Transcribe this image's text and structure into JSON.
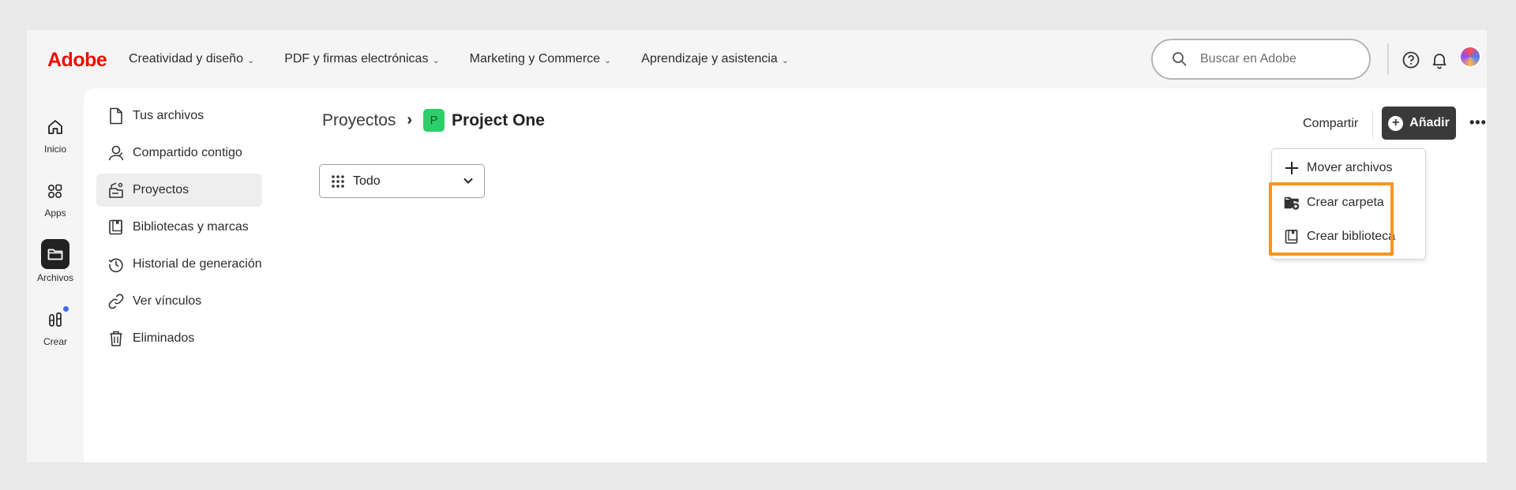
{
  "brand": {
    "name": "Adobe",
    "color": "#eb1000"
  },
  "nav": [
    {
      "label": "Creatividad y diseño"
    },
    {
      "label": "PDF y firmas electrónicas"
    },
    {
      "label": "Marketing y Commerce"
    },
    {
      "label": "Aprendizaje y asistencia"
    }
  ],
  "search": {
    "placeholder": "Buscar en Adobe"
  },
  "rail": [
    {
      "label": "Inicio",
      "icon": "home-icon"
    },
    {
      "label": "Apps",
      "icon": "apps-icon"
    },
    {
      "label": "Archivos",
      "icon": "folder-icon"
    },
    {
      "label": "Crear",
      "icon": "create-icon"
    }
  ],
  "sidebar": [
    {
      "label": "Tus archivos",
      "icon": "file-icon"
    },
    {
      "label": "Compartido contigo",
      "icon": "shared-user-icon"
    },
    {
      "label": "Proyectos",
      "icon": "projects-icon"
    },
    {
      "label": "Bibliotecas y marcas",
      "icon": "library-icon"
    },
    {
      "label": "Historial de generación",
      "icon": "history-icon"
    },
    {
      "label": "Ver vínculos",
      "icon": "link-icon"
    },
    {
      "label": "Eliminados",
      "icon": "trash-icon"
    }
  ],
  "breadcrumb": {
    "parent": "Proyectos",
    "separator": "›",
    "badge": "P",
    "current": "Project One"
  },
  "filter": {
    "value": "Todo"
  },
  "actions": {
    "share": "Compartir",
    "add": "Añadir",
    "more": "•••"
  },
  "menu": [
    {
      "label": "Mover archivos",
      "icon": "plus-icon"
    },
    {
      "label": "Crear carpeta",
      "icon": "new-folder-icon"
    },
    {
      "label": "Crear biblioteca",
      "icon": "library-icon"
    }
  ],
  "colors": {
    "highlight": "#f6961f",
    "project_badge": "#2ecf6a",
    "add_button": "#3a3a3a"
  }
}
